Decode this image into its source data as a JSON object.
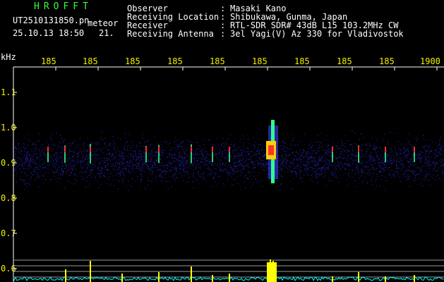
{
  "header": {
    "logo": "HROFFT",
    "filename": "UT2510131850.pn",
    "meteor_label": "meteor",
    "timestamp": "25.10.13 18:50",
    "count": "21.",
    "fields": [
      {
        "label": "Observer",
        "sep": ":",
        "value": "Masaki Kano"
      },
      {
        "label": "Receiving Location",
        "sep": ":",
        "value": "Shibukawa, Gunma, Japan"
      },
      {
        "label": "Receiver",
        "sep": ":",
        "value": "RTL-SDR SDR# 43dB L15 103.2MHz CW"
      },
      {
        "label": "Receiving Antenna",
        "sep": ":",
        "value": "3el Yagi(V) Az 330 for Vladivostok"
      }
    ]
  },
  "axes": {
    "y_unit": "kHz",
    "y_ticks": [
      "1.1",
      "1.0",
      "0.9",
      "0.8",
      "0.7",
      "0.6"
    ],
    "x_ticks": [
      "185",
      "185",
      "185",
      "185",
      "185",
      "185",
      "185",
      "185",
      "185",
      "1900"
    ]
  },
  "colors": {
    "background": "#000000",
    "header_text": "#ffffff",
    "logo": "#35ff35",
    "tick_labels": "#f0f000",
    "axis": "#ffffff",
    "noise_band": "#2020c0",
    "signal_hot": "#ff3030",
    "signal_warm": "#ffd000",
    "signal_cool": "#30ff90",
    "amplitude_trace": "#00ffff",
    "amplitude_peak": "#ffff00"
  }
}
